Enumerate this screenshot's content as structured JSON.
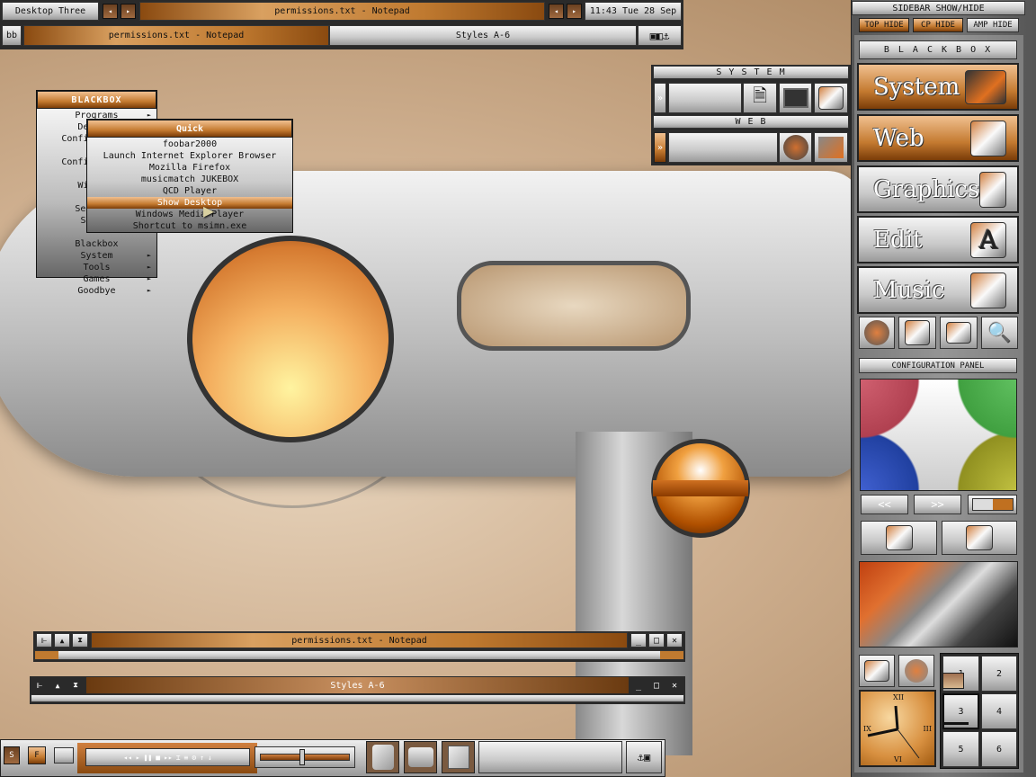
{
  "toolbar": {
    "workspace": "Desktop Three",
    "window_title": "permissions.txt - Notepad",
    "clock": "11:43 Tue 28 Sep"
  },
  "taskbar": {
    "label": "bb",
    "tasks": [
      "permissions.txt - Notepad",
      "Styles A-6"
    ]
  },
  "menu": {
    "title": "BLACKBOX",
    "items": [
      "Programs",
      "Desktop",
      "Configuration",
      "Configuration",
      "Windows",
      "Settings",
      "Styles",
      "Blackbox",
      "System",
      "Tools",
      "Games",
      "Goodbye"
    ]
  },
  "submenu": {
    "title": "Quick",
    "items": [
      "foobar2000",
      "Launch Internet Explorer Browser",
      "Mozilla Firefox",
      "musicmatch JUKEBOX",
      "QCD Player",
      "Show Desktop",
      "Windows Media Player",
      "Shortcut to msimn.exe"
    ],
    "selected": "Show Desktop"
  },
  "launcher": {
    "system_title": "S Y S T E M",
    "web_title": "W E B"
  },
  "sidebar": {
    "title": "SIDEBAR SHOW/HIDE",
    "buttons": [
      "TOP HIDE",
      "CP HIDE",
      "AMP HIDE"
    ],
    "brand": "B L A C K B O X",
    "sections": [
      "System",
      "Web",
      "Graphics",
      "Edit",
      "Music"
    ],
    "config_title": "CONFIGURATION PANEL",
    "prev": "<<",
    "next": ">>",
    "workspaces": [
      "1",
      "2",
      "3",
      "4",
      "5",
      "6"
    ],
    "clock_numerals": [
      "XII",
      "III",
      "VI",
      "IX"
    ]
  },
  "windows": [
    {
      "title": "permissions.txt - Notepad"
    },
    {
      "title": "Styles A-6"
    }
  ],
  "bottom": {
    "buttons": [
      "S",
      "F"
    ]
  },
  "colors": {
    "accent": "#c47a30",
    "chrome": "#c9c9c9"
  }
}
